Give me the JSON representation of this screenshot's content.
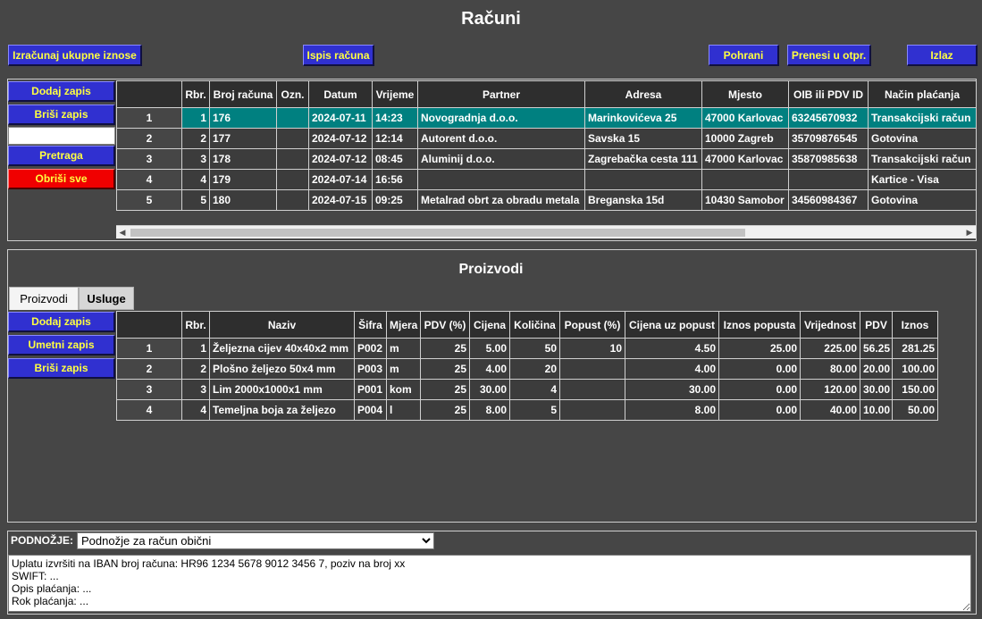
{
  "title": "Računi",
  "toolbar": {
    "calc_label": "Izračunaj ukupne iznose",
    "print_label": "Ispis računa",
    "save_label": "Pohrani",
    "transfer_label": "Prenesi u otpr.",
    "exit_label": "Izlaz"
  },
  "invoice_side": {
    "add_label": "Dodaj zapis",
    "delete_label": "Briši zapis",
    "search_value": "",
    "search_label": "Pretraga",
    "clear_label": "Obriši sve"
  },
  "invoices": {
    "columns": [
      "Rbr.",
      "Broj računa",
      "Ozn.",
      "Datum",
      "Vrijeme",
      "Partner",
      "Adresa",
      "Mjesto",
      "OIB ili PDV ID",
      "Način plaćanja"
    ],
    "rows": [
      {
        "n": "1",
        "rbr": "1",
        "broj": "176",
        "ozn": "",
        "datum": "2024-07-11",
        "vrijeme": "14:23",
        "partner": "Novogradnja d.o.o.",
        "adresa": "Marinkovićeva 25",
        "mjesto": "47000 Karlovac",
        "oib": "63245670932",
        "nacin": "Transakcijski račun",
        "selected": true
      },
      {
        "n": "2",
        "rbr": "2",
        "broj": "177",
        "ozn": "",
        "datum": "2024-07-12",
        "vrijeme": "12:14",
        "partner": "Autorent d.o.o.",
        "adresa": "Savska 15",
        "mjesto": "10000 Zagreb",
        "oib": "35709876545",
        "nacin": "Gotovina",
        "selected": false
      },
      {
        "n": "3",
        "rbr": "3",
        "broj": "178",
        "ozn": "",
        "datum": "2024-07-12",
        "vrijeme": "08:45",
        "partner": "Aluminij d.o.o.",
        "adresa": "Zagrebačka cesta 111",
        "mjesto": "47000 Karlovac",
        "oib": "35870985638",
        "nacin": "Transakcijski račun",
        "selected": false
      },
      {
        "n": "4",
        "rbr": "4",
        "broj": "179",
        "ozn": "",
        "datum": "2024-07-14",
        "vrijeme": "16:56",
        "partner": "",
        "adresa": "",
        "mjesto": "",
        "oib": "",
        "nacin": "Kartice - Visa",
        "selected": false
      },
      {
        "n": "5",
        "rbr": "5",
        "broj": "180",
        "ozn": "",
        "datum": "2024-07-15",
        "vrijeme": "09:25",
        "partner": "Metalrad obrt za obradu metala",
        "adresa": "Breganska 15d",
        "mjesto": "10430 Samobor",
        "oib": "34560984367",
        "nacin": "Gotovina",
        "selected": false
      }
    ]
  },
  "products_section": {
    "title": "Proizvodi",
    "tabs": [
      "Proizvodi",
      "Usluge"
    ],
    "add_label": "Dodaj zapis",
    "insert_label": "Umetni zapis",
    "delete_label": "Briši zapis",
    "columns": [
      "Rbr.",
      "Naziv",
      "Šifra",
      "Mjera",
      "PDV (%)",
      "Cijena",
      "Količina",
      "Popust (%)",
      "Cijena uz popust",
      "Iznos popusta",
      "Vrijednost",
      "PDV",
      "Iznos"
    ],
    "rows": [
      {
        "n": "1",
        "rbr": "1",
        "naziv": "Željezna cijev 40x40x2 mm",
        "sifra": "P002",
        "mjera": "m",
        "pdv": "25",
        "cijena": "5.00",
        "kolicina": "50",
        "popust": "10",
        "cijena_popust": "4.50",
        "iznos_popusta": "25.00",
        "vrijednost": "225.00",
        "pdv_iznos": "56.25",
        "iznos": "281.25"
      },
      {
        "n": "2",
        "rbr": "2",
        "naziv": "Plošno željezo 50x4 mm",
        "sifra": "P003",
        "mjera": "m",
        "pdv": "25",
        "cijena": "4.00",
        "kolicina": "20",
        "popust": "",
        "cijena_popust": "4.00",
        "iznos_popusta": "0.00",
        "vrijednost": "80.00",
        "pdv_iznos": "20.00",
        "iznos": "100.00"
      },
      {
        "n": "3",
        "rbr": "3",
        "naziv": "Lim 2000x1000x1 mm",
        "sifra": "P001",
        "mjera": "kom",
        "pdv": "25",
        "cijena": "30.00",
        "kolicina": "4",
        "popust": "",
        "cijena_popust": "30.00",
        "iznos_popusta": "0.00",
        "vrijednost": "120.00",
        "pdv_iznos": "30.00",
        "iznos": "150.00"
      },
      {
        "n": "4",
        "rbr": "4",
        "naziv": "Temeljna boja za željezo",
        "sifra": "P004",
        "mjera": "l",
        "pdv": "25",
        "cijena": "8.00",
        "kolicina": "5",
        "popust": "",
        "cijena_popust": "8.00",
        "iznos_popusta": "0.00",
        "vrijednost": "40.00",
        "pdv_iznos": "10.00",
        "iznos": "50.00"
      }
    ]
  },
  "footer": {
    "label": "PODNOŽJE:",
    "selected": "Podnožje za račun obični",
    "text": "Uplatu izvršiti na IBAN broj računa: HR96 1234 5678 9012 3456 7, poziv na broj xx\nSWIFT: ...\nOpis plaćanja: ...\nRok plaćanja: ..."
  },
  "colors": {
    "background": "#464646",
    "button": "#3030d0",
    "button_text": "#ffff40",
    "danger": "#f00000",
    "selected_row": "#008080"
  },
  "icons": {
    "scroll_left": "triangle-left-icon",
    "scroll_right": "triangle-right-icon"
  }
}
